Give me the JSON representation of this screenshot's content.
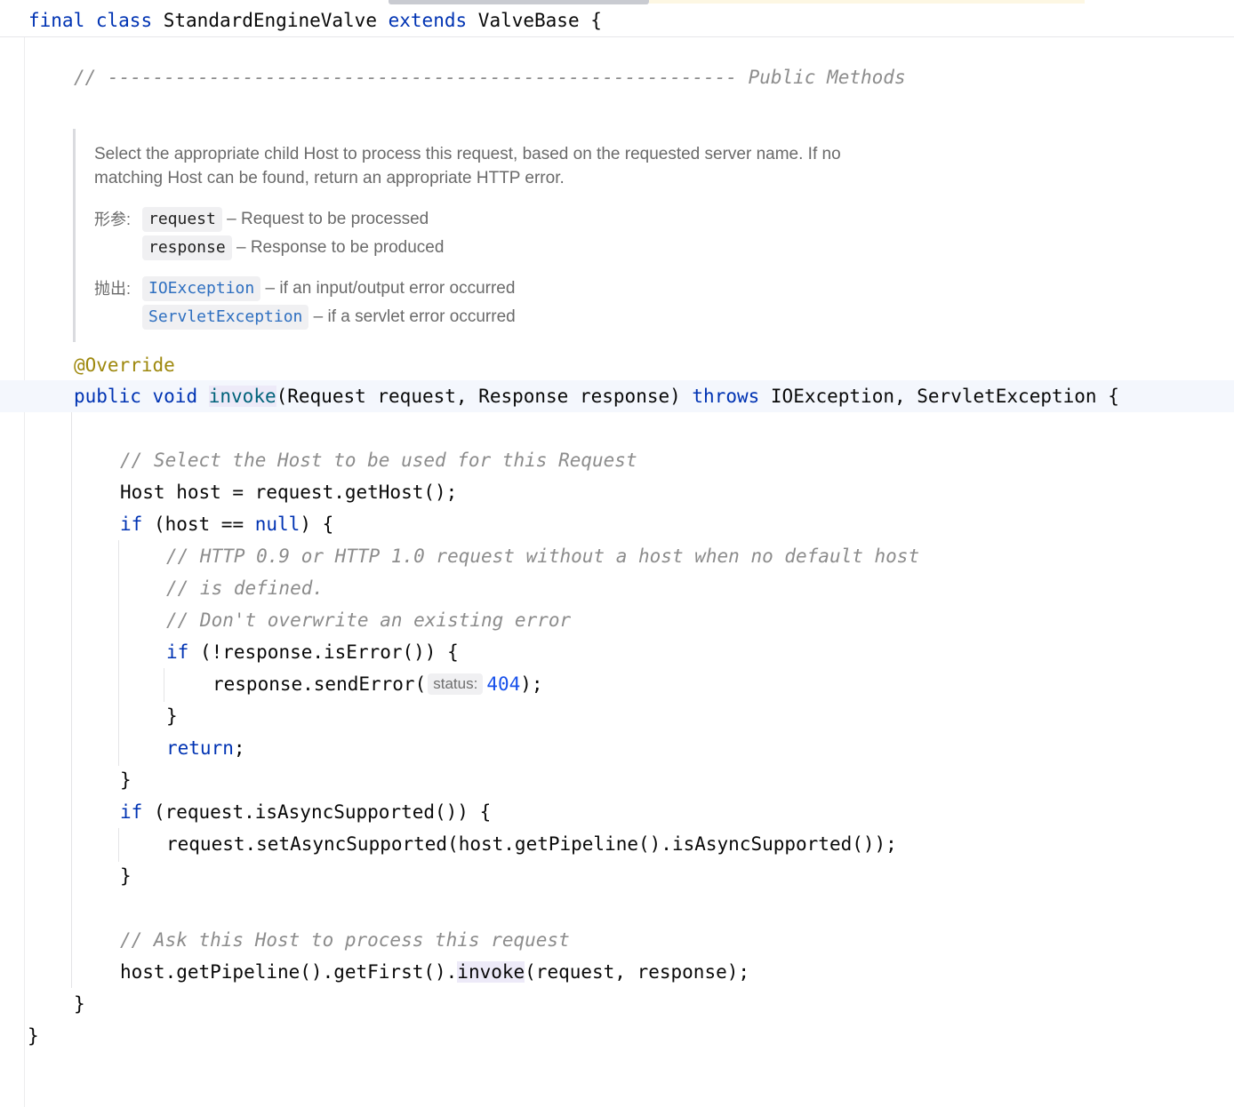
{
  "class_header": {
    "keyword_final": "final",
    "keyword_class": "class",
    "class_name": "StandardEngineValve",
    "keyword_extends": "extends",
    "parent": "ValveBase",
    "brace": "{"
  },
  "section_comment": "// -------------------------------------------------------- Public Methods",
  "javadoc": {
    "description": "Select the appropriate child Host to process this request, based on the requested server name. If no matching Host can be found, return an appropriate HTTP error.",
    "params_label": "形参:",
    "params": [
      {
        "name": "request",
        "desc": "– Request to be processed"
      },
      {
        "name": "response",
        "desc": "– Response to be produced"
      }
    ],
    "throws_label": "抛出:",
    "throws": [
      {
        "name": "IOException",
        "desc": "– if an input/output error occurred"
      },
      {
        "name": "ServletException",
        "desc": "– if a servlet error occurred"
      }
    ]
  },
  "code": {
    "annotation": "@Override",
    "sig_public": "public",
    "sig_void": "void",
    "sig_method": "invoke",
    "sig_params": "(Request request, Response response) ",
    "sig_throws": "throws",
    "sig_exceptions": " IOException, ServletException {",
    "cmt_select": "// Select the Host to be used for this Request",
    "host_assign": "Host host = request.getHost();",
    "if_kw": "if",
    "if_host_open": " (host == ",
    "null_kw": "null",
    "if_host_close": ") {",
    "cmt_http_1": "// HTTP 0.9 or HTTP 1.0 request without a host when no default host",
    "cmt_http_2": "// is defined.",
    "cmt_http_3": "// Don't overwrite an existing error",
    "if_error_rest": " (!response.isError()) {",
    "send_error_call": "response.sendError(",
    "param_hint": "status:",
    "status_code": "404",
    "send_error_end": ");",
    "close_brace": "}",
    "return_kw": "return",
    "semicolon": ";",
    "if_async_rest": " (request.isAsyncSupported()) {",
    "set_async": "request.setAsyncSupported(host.getPipeline().isAsyncSupported());",
    "cmt_ask": "// Ask this Host to process this request",
    "pipeline_call": "host.getPipeline().getFirst().",
    "invoke_usage": "invoke",
    "pipeline_args": "(request, response);"
  }
}
